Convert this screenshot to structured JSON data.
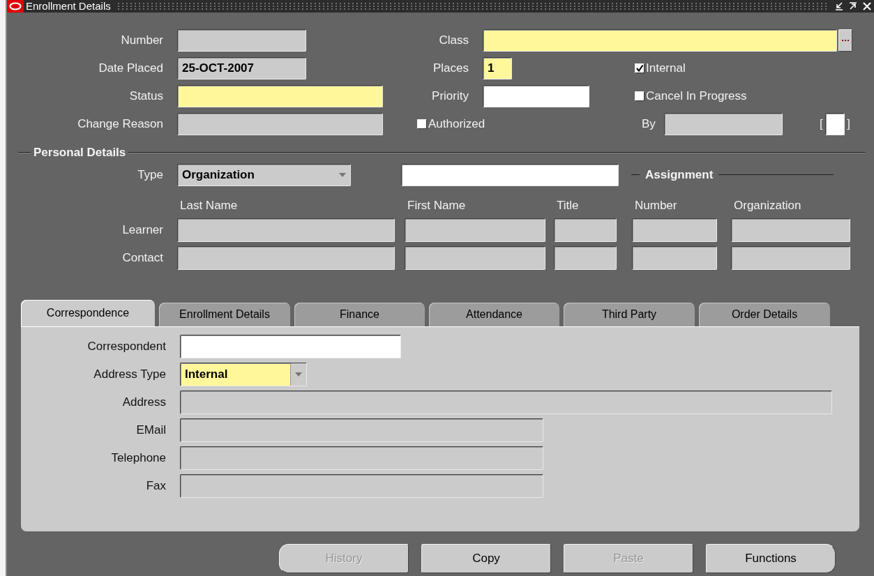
{
  "window": {
    "title": "Enrollment Details"
  },
  "fields": [
    {
      "label": "Number",
      "kind": "readonly"
    },
    {
      "label": "Class",
      "kind": "required",
      "lov": true
    },
    {
      "label": "Date Placed",
      "kind": "readonly",
      "value": "25-OCT-2007"
    },
    {
      "label": "Places",
      "kind": "required",
      "value": "1"
    },
    {
      "label": "Status",
      "kind": "required"
    },
    {
      "label": "Priority",
      "kind": "editable"
    },
    {
      "label": "Change Reason",
      "kind": "readonly"
    },
    {
      "label": "By",
      "kind": "readonly"
    }
  ],
  "checkboxes": [
    {
      "label": "Internal",
      "checked": true
    },
    {
      "label": "Cancel In Progress",
      "checked": false
    },
    {
      "label": "Authorized",
      "checked": false
    }
  ],
  "bracket_field": {
    "left": "[",
    "right": "]",
    "kind": "editable"
  },
  "personal_details": {
    "title": "Personal Details",
    "type": {
      "label": "Type",
      "value": "Organization"
    },
    "name_field": {
      "kind": "editable"
    },
    "assignment_title": "Assignment",
    "columns": [
      "Last Name",
      "First Name",
      "Title",
      "Number",
      "Organization"
    ],
    "rows": [
      {
        "label": "Learner"
      },
      {
        "label": "Contact"
      }
    ]
  },
  "tabs": [
    {
      "label": "Correspondence",
      "selected": true
    },
    {
      "label": "Enrollment Details",
      "selected": false
    },
    {
      "label": "Finance",
      "selected": false
    },
    {
      "label": "Attendance",
      "selected": false
    },
    {
      "label": "Third Party",
      "selected": false
    },
    {
      "label": "Order Details",
      "selected": false
    }
  ],
  "correspondence": [
    {
      "label": "Correspondent",
      "kind": "editable"
    },
    {
      "label": "Address Type",
      "kind": "required",
      "value": "Internal",
      "dropdown": true
    },
    {
      "label": "Address",
      "kind": "readonly"
    },
    {
      "label": "EMail",
      "kind": "readonly"
    },
    {
      "label": "Telephone",
      "kind": "readonly"
    },
    {
      "label": "Fax",
      "kind": "readonly"
    }
  ],
  "buttons": [
    {
      "label": "History",
      "disabled": true
    },
    {
      "label": "Copy",
      "disabled": false
    },
    {
      "label": "Paste",
      "disabled": true
    },
    {
      "label": "Functions",
      "disabled": false
    }
  ]
}
